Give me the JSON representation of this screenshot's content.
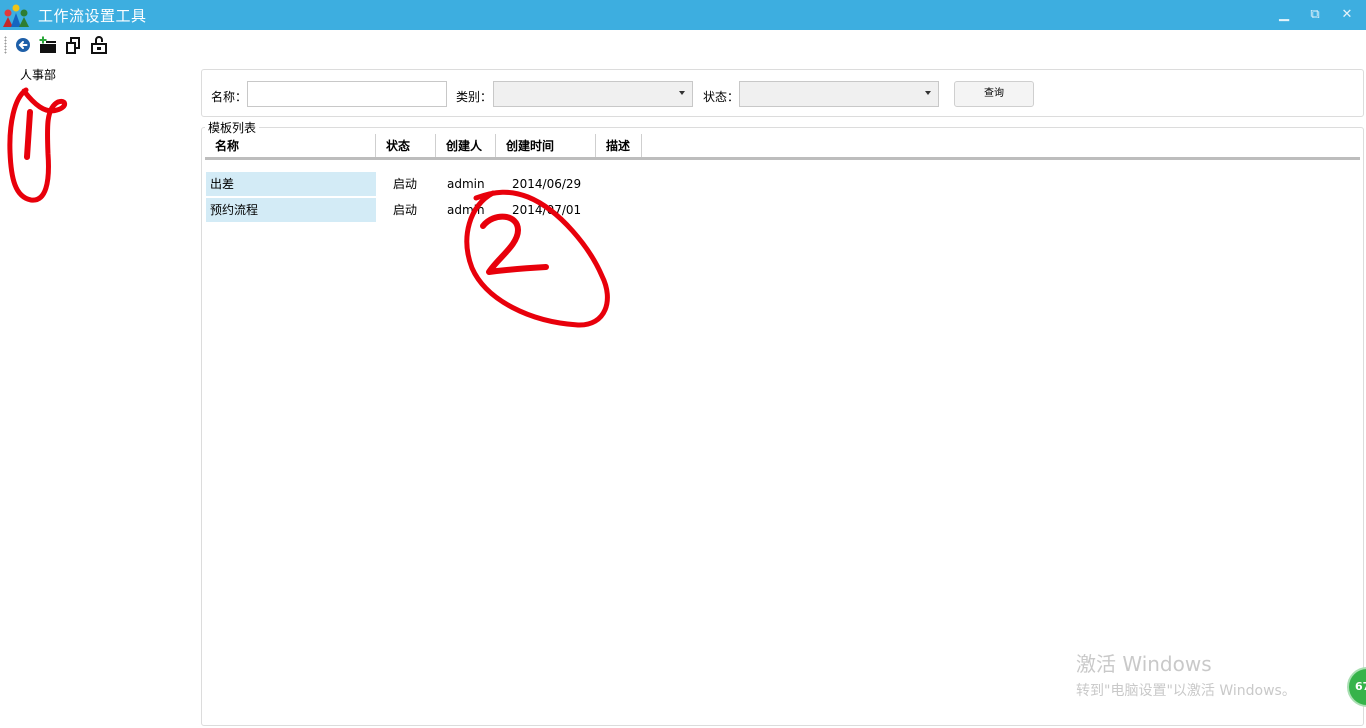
{
  "window": {
    "title": "工作流设置工具",
    "controls": {
      "minimize": "▁",
      "restore": "⧉",
      "close": "✕"
    },
    "accent_color": "#3daee0"
  },
  "toolbar": {
    "icons": [
      "back-icon",
      "add-icon",
      "copy-icon",
      "permissions-icon"
    ]
  },
  "tree": {
    "items": [
      {
        "label": "人事部"
      }
    ]
  },
  "search": {
    "name_label": "名称：",
    "name_value": "",
    "category_label": "类别：",
    "category_value": "",
    "status_label": "状态：",
    "status_value": "",
    "query_button": "查询"
  },
  "template_list": {
    "title": "模板列表",
    "columns": [
      "名称",
      "状态",
      "创建人",
      "创建时间",
      "描述"
    ],
    "rows": [
      {
        "name": "出差",
        "status": "启动",
        "creator": "admin",
        "created": "2014/06/29",
        "desc": ""
      },
      {
        "name": "预约流程",
        "status": "启动",
        "creator": "admin",
        "created": "2014/07/01",
        "desc": ""
      }
    ],
    "selection_color": "#d3ebf6"
  },
  "annotations": {
    "marks": [
      "1",
      "2"
    ],
    "color": "#e8000b"
  },
  "watermark": {
    "title": "激活 Windows",
    "subtitle": "转到\"电脑设置\"以激活 Windows。"
  },
  "badge": {
    "text": "67",
    "color": "#36b34a"
  }
}
